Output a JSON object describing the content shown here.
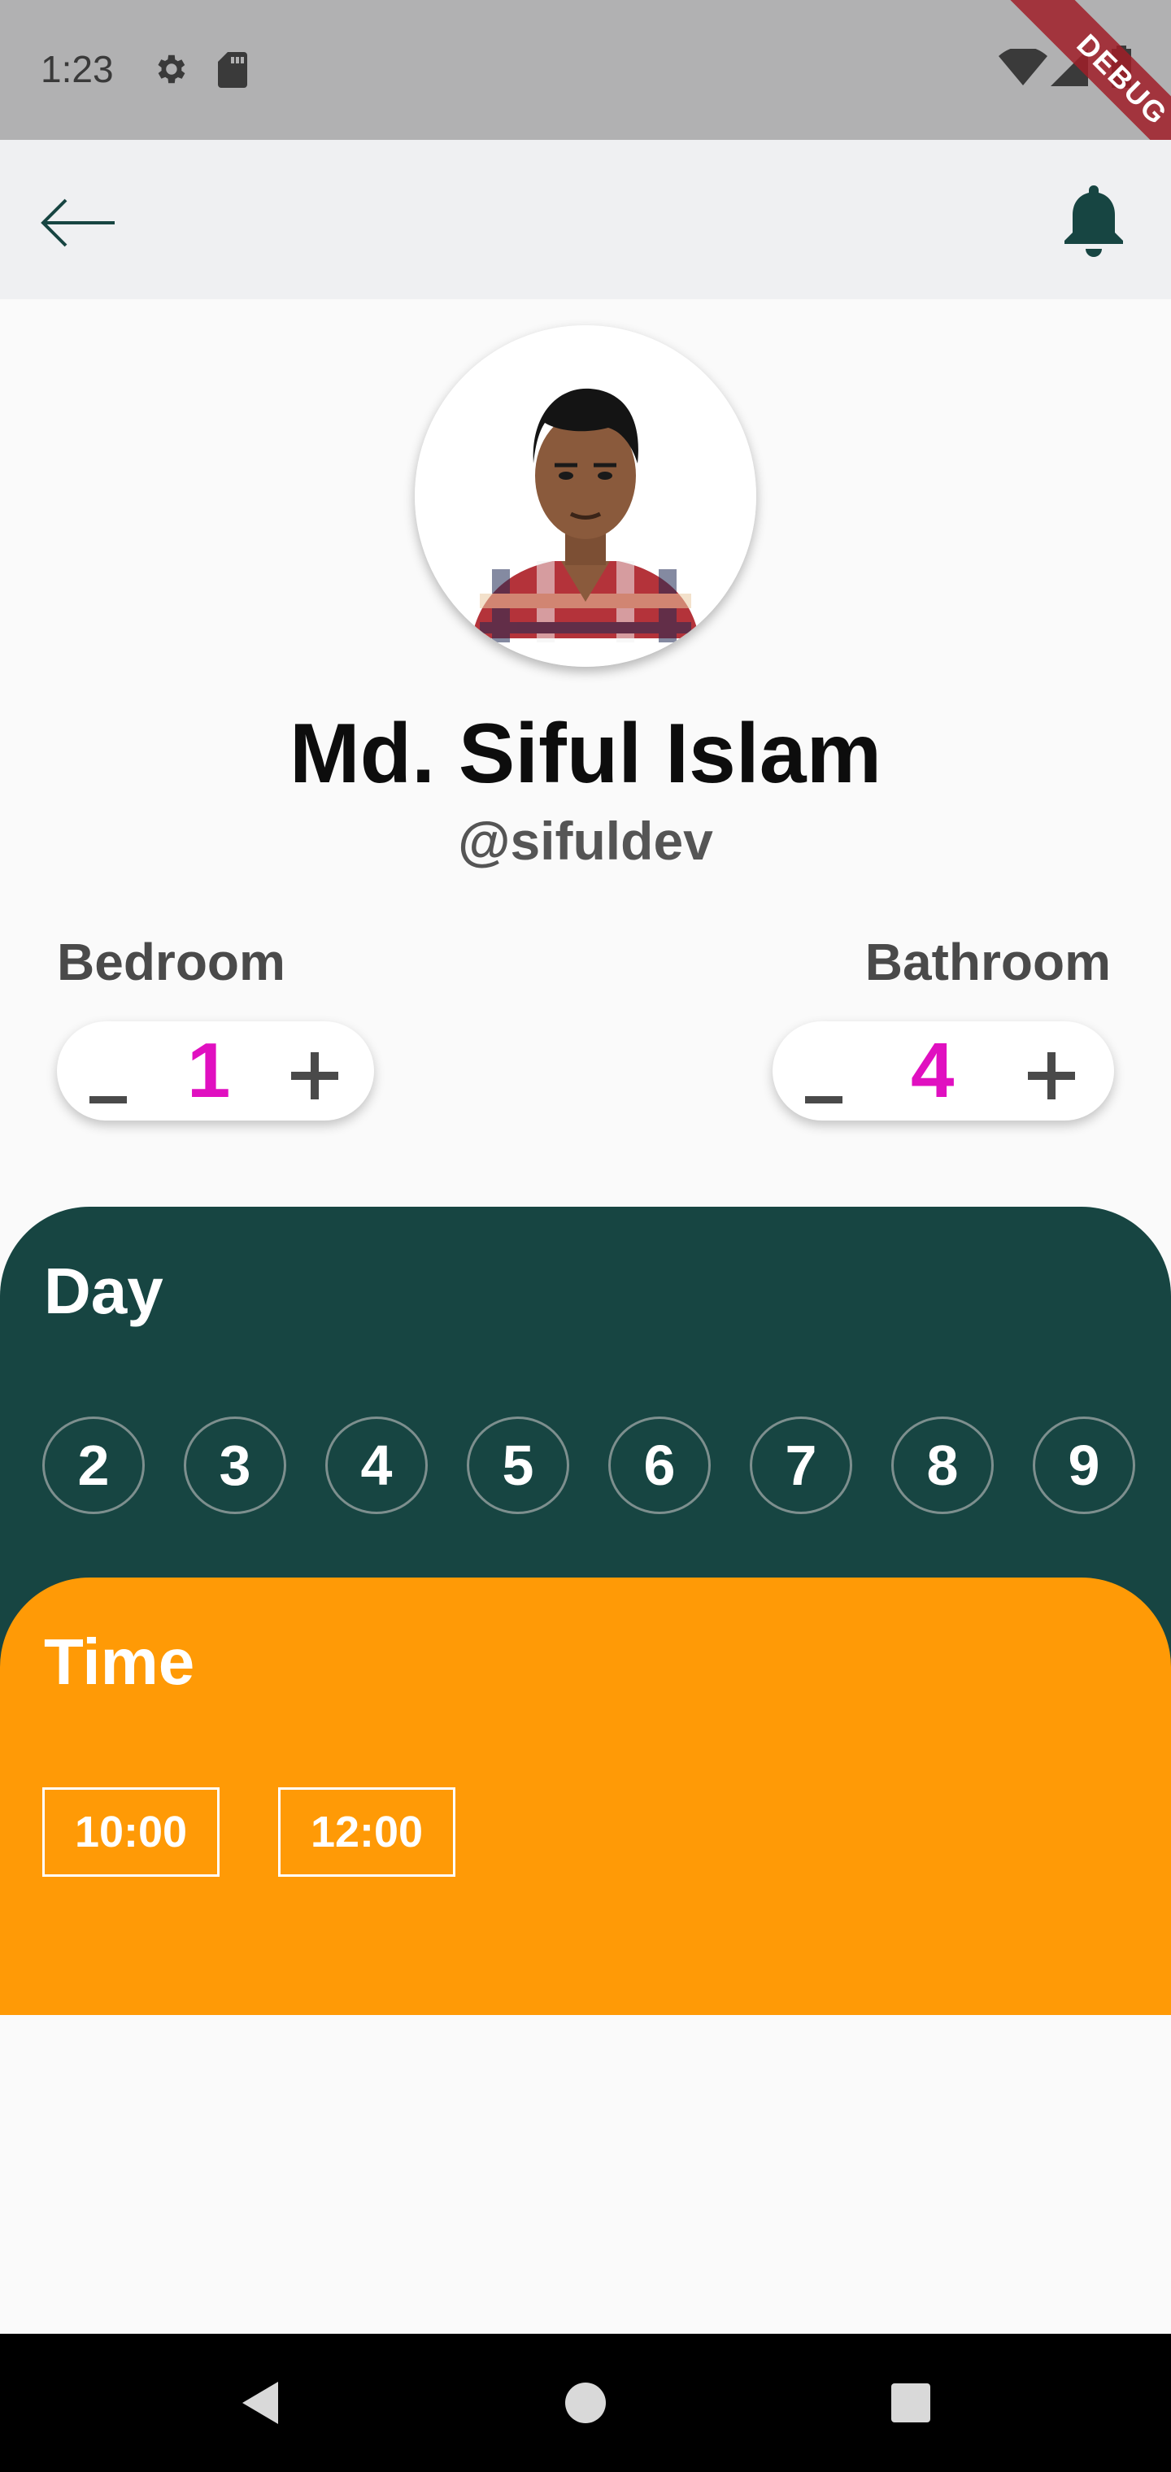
{
  "status_bar": {
    "time": "1:23",
    "debug_label": "DEBUG"
  },
  "profile": {
    "name": "Md. Siful Islam",
    "handle": "@sifuldev"
  },
  "counters": {
    "bedroom": {
      "label": "Bedroom",
      "value": "1"
    },
    "bathroom": {
      "label": "Bathroom",
      "value": "4"
    }
  },
  "day_section": {
    "title": "Day",
    "days": [
      "2",
      "3",
      "4",
      "5",
      "6",
      "7",
      "8",
      "9"
    ]
  },
  "time_section": {
    "title": "Time",
    "times": [
      "10:00",
      "12:00"
    ]
  },
  "colors": {
    "accent": "#e010c0",
    "day_panel": "#174542",
    "time_panel": "#ff9a06",
    "app_bar": "#eff0f2"
  },
  "icons": {
    "back": "arrow-left-icon",
    "notifications": "bell-icon"
  }
}
